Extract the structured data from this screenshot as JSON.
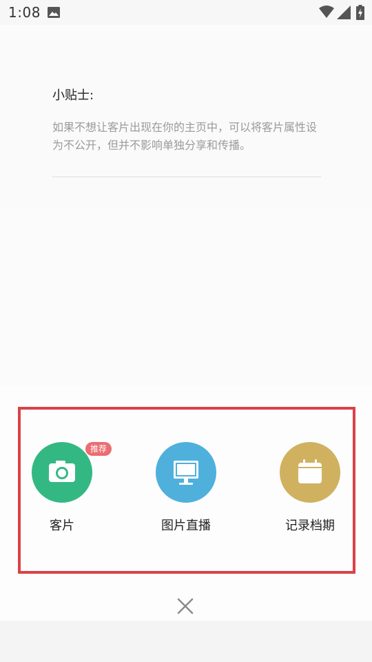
{
  "status_bar": {
    "time": "1:08",
    "icons": [
      "gallery-icon",
      "wifi-icon",
      "signal-icon",
      "battery-charging-icon"
    ]
  },
  "tips": {
    "title": "小贴士:",
    "body": "如果不想让客片出现在你的主页中，可以将客片属性设为不公开，但并不影响单独分享和传播。"
  },
  "actions": [
    {
      "label": "客片",
      "icon": "camera-icon",
      "color": "#34b883",
      "badge": "推荐"
    },
    {
      "label": "图片直播",
      "icon": "monitor-icon",
      "color": "#4fb0dc"
    },
    {
      "label": "记录档期",
      "icon": "calendar-icon",
      "color": "#cfb160"
    }
  ],
  "colors": {
    "highlight_border": "#dc4147",
    "badge_bg": "#eb6d72"
  },
  "close": {
    "icon": "close-icon"
  }
}
